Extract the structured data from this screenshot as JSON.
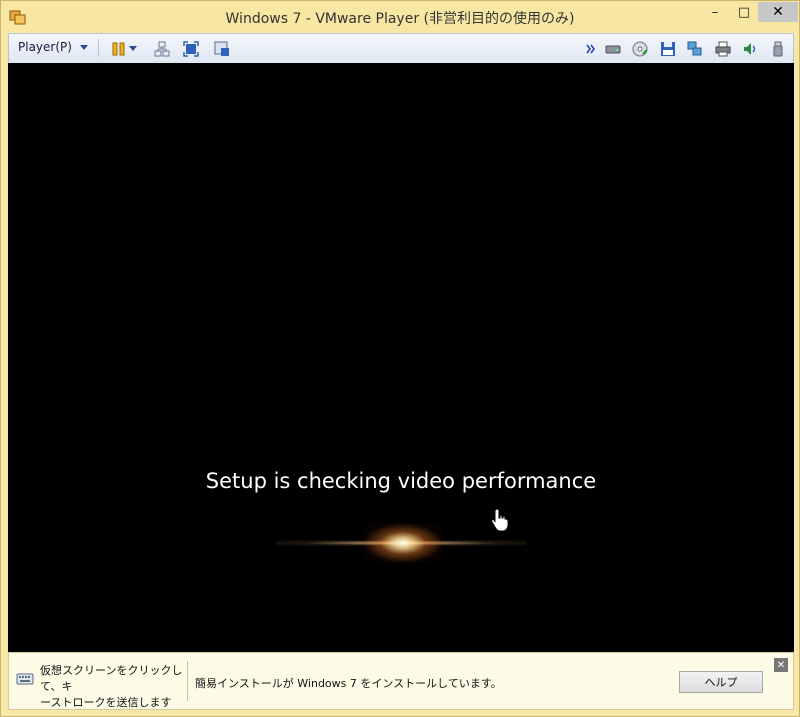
{
  "titlebar": {
    "title": "Windows 7 - VMware Player (非営利目的の使用のみ)",
    "minimize_icon": "minimize-icon",
    "maximize_icon": "maximize-icon",
    "close_icon": "close-icon"
  },
  "toolbar": {
    "player_menu_label": "Player(P)",
    "left_icons": [
      "pause-icon",
      "dropdown-arrow-icon",
      "network-icon",
      "fullscreen-icon",
      "unity-icon"
    ],
    "right_icons": [
      "more-chevron-icon",
      "hard-disk-icon",
      "cd-dvd-icon",
      "floppy-icon",
      "network-adapter-icon",
      "printer-icon",
      "sound-icon",
      "usb-icon"
    ]
  },
  "vm": {
    "message": "Setup is checking video performance"
  },
  "bottombar": {
    "hint_line1": "仮想スクリーンをクリックして、キ",
    "hint_line2": "ーストロークを送信します",
    "status": "簡易インストールが Windows 7 をインストールしています。",
    "help_label": "ヘルプ"
  },
  "colors": {
    "titlebar_bg": "#f7e7a2",
    "vm_bg": "#000000",
    "toolbar_accent": "#2a4a9a"
  }
}
